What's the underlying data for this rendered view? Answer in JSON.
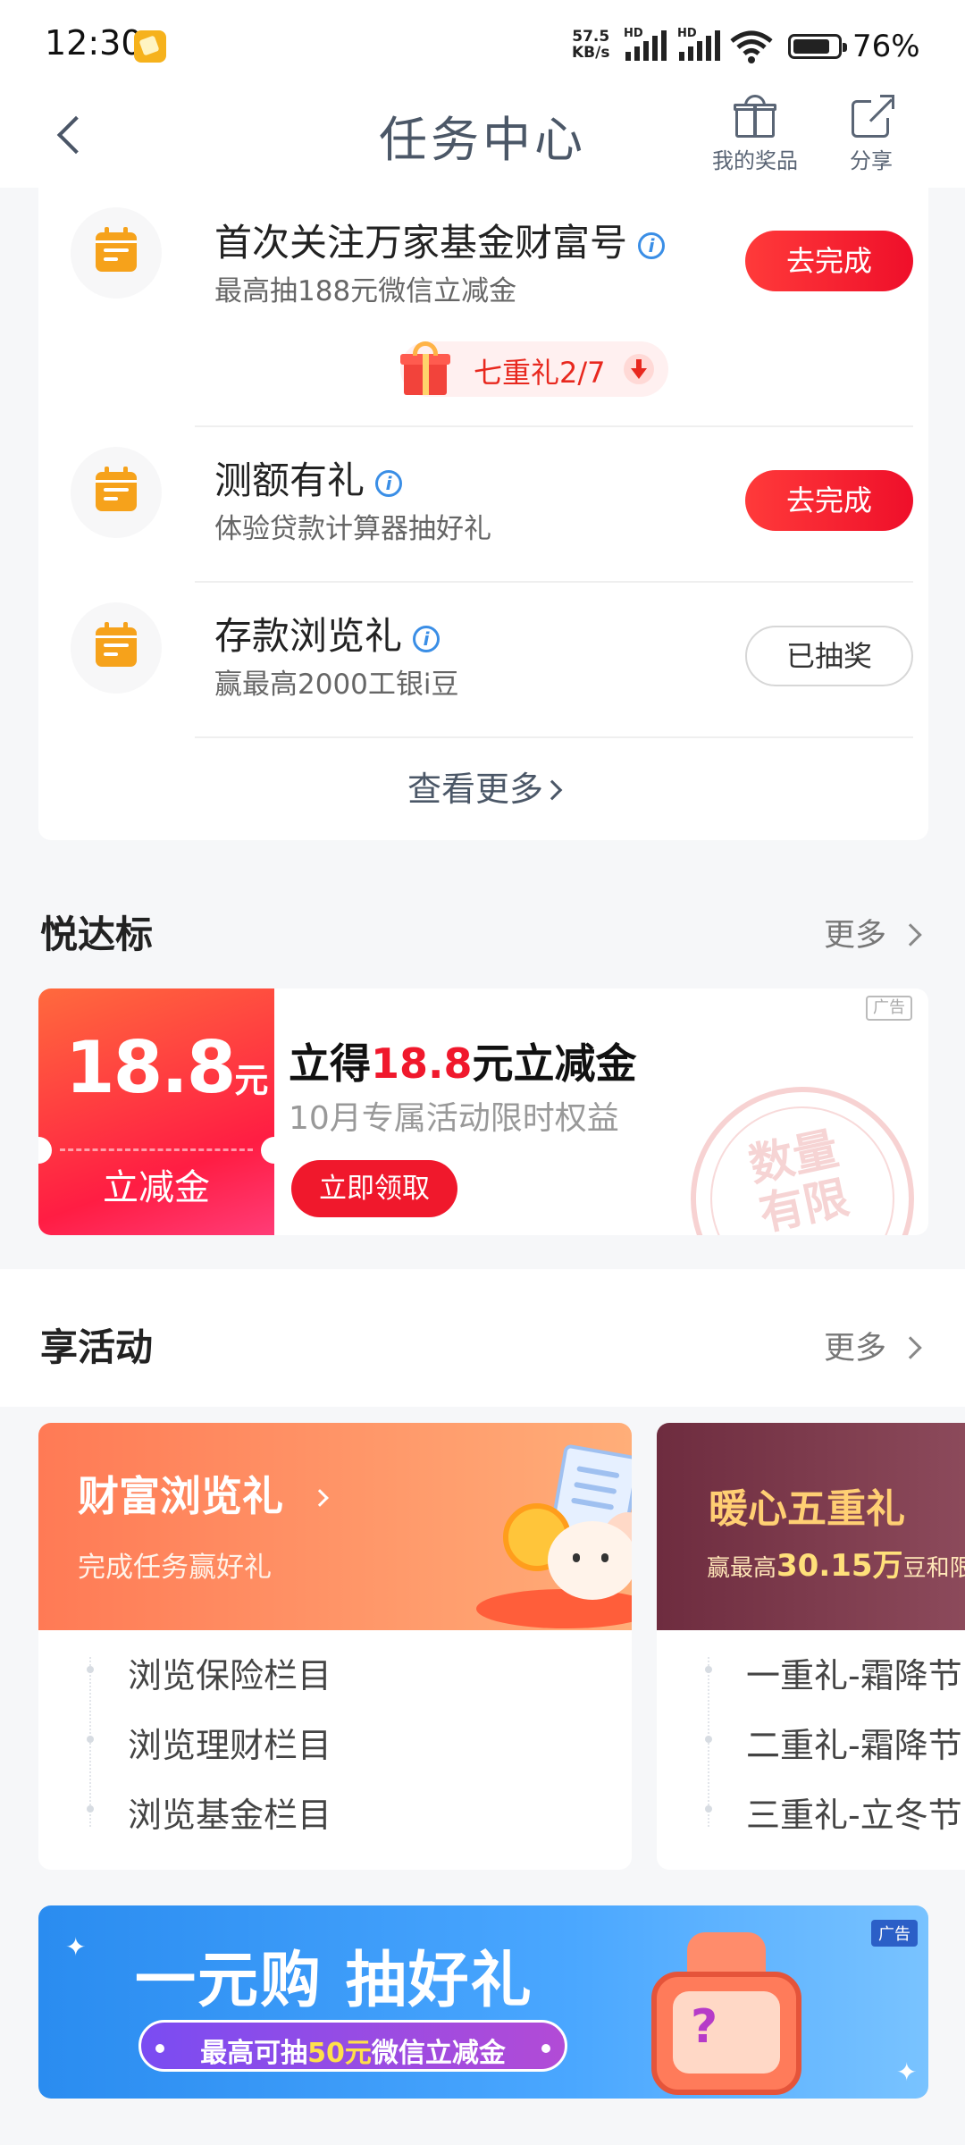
{
  "status_bar": {
    "time": "12:30",
    "net_speed_value": "57.5",
    "net_speed_unit": "KB/s",
    "signal_label": "HD",
    "battery": "76%"
  },
  "header": {
    "title": "任务中心",
    "my_prizes": "我的奖品",
    "share": "分享"
  },
  "tasks": [
    {
      "title": "首次关注万家基金财富号",
      "subtitle": "最高抽188元微信立减金",
      "action": "去完成",
      "done": false
    },
    {
      "title": "测额有礼",
      "subtitle": "体验贷款计算器抽好礼",
      "action": "去完成",
      "done": false
    },
    {
      "title": "存款浏览礼",
      "subtitle": "赢最高2000工银i豆",
      "action": "已抽奖",
      "done": true
    }
  ],
  "seven_gift": {
    "label": "七重礼2/7"
  },
  "info_glyph": "i",
  "see_more": "查看更多",
  "section_yuedabiao": {
    "title": "悦达标",
    "more": "更多"
  },
  "coupon_ad": {
    "amount": "18.8",
    "unit": "元",
    "kind": "立减金",
    "title_pre": "立得",
    "title_num": "18.8",
    "title_post": "元立减金",
    "subtitle": "10月专属活动限时权益",
    "button": "立即领取",
    "badge": "广告",
    "stamp": "数量有限"
  },
  "section_activities": {
    "title": "享活动",
    "more": "更多"
  },
  "activities": [
    {
      "title": "财富浏览礼",
      "subtitle": "完成任务赢好礼",
      "items": [
        "浏览保险栏目",
        "浏览理财栏目",
        "浏览基金栏目"
      ]
    },
    {
      "title": "暖心五重礼",
      "subtitle_pre": "赢最高",
      "subtitle_num": "30.15万",
      "subtitle_post": "豆和限",
      "items": [
        "一重礼-霜降节",
        "二重礼-霜降节",
        "三重礼-立冬节"
      ]
    }
  ],
  "bottom_banner": {
    "title": "一元购 抽好礼",
    "pill_pre": "最高可抽",
    "pill_num": "50元",
    "pill_post": "微信立减金",
    "badge": "广告",
    "machine_glyph": "?"
  },
  "colors": {
    "accent_red": "#f0182c",
    "task_icon_orange": "#f6a21b",
    "info_blue": "#3a8ee6"
  }
}
